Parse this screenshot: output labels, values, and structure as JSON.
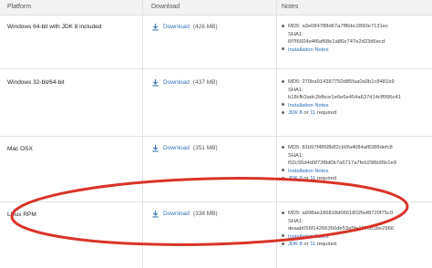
{
  "header": {
    "platform": "Platform",
    "download": "Download",
    "notes": "Notes"
  },
  "rows": [
    {
      "platform": "Windows 64-bit with JDK 8 included",
      "download_label": "Download",
      "size": "(426 MB)",
      "md5": "MD5: a3e084788d67a7f8bbc2890e7131ec",
      "sha1_label": "SHA1:",
      "sha1": "6f7f6604e4f6af68e1a86e747e2d23d6ecd",
      "install_notes": "Installation Notes"
    },
    {
      "platform": "Windows 32-bit/64-bit",
      "download_label": "Download",
      "size": "(437 MB)",
      "md5": "MD5: 270ba914387750d85faa0a0b1c8481b9",
      "sha1_label": "SHA1:",
      "sha1": "b18cfb3adc2bfbce1e6e6e454a637d14cff996c41",
      "install_notes": "Installation Notes",
      "jdk_a": "JDK 8",
      "jdk_or": "or",
      "jdk_b": "11",
      "jdk_suffix": "required"
    },
    {
      "platform": "Mac OSX",
      "download_label": "Download",
      "size": "(351 MB)",
      "md5": "MD5: 81b57f4868b82cb0fa4084af8388defc8",
      "sha1_label": "SHA1:",
      "sha1": "f02c55d4d9f73f8d0b7a6717a7feb298b95b1e9",
      "install_notes": "Installation Notes",
      "jdk_a": "JDK 8",
      "jdk_or": "or",
      "jdk_b": "11",
      "jdk_suffix": "required"
    },
    {
      "platform": "Linux RPM",
      "download_label": "Download",
      "size": "(338 MB)",
      "md5": "MD5: a998ae186818d0661802fa48720f75c0",
      "sha1_label": "SHA1:",
      "sha1": "deaab056f14266356de53a5fe137eb1be2966",
      "install_notes": "Installation Notes",
      "jdk_a": "JDK 8",
      "jdk_or": "or",
      "jdk_b": "11",
      "jdk_suffix": "required"
    }
  ],
  "colors": {
    "link": "#3a73b5",
    "annotation": "#d9332a",
    "header_bg": "#f3f3f3"
  }
}
